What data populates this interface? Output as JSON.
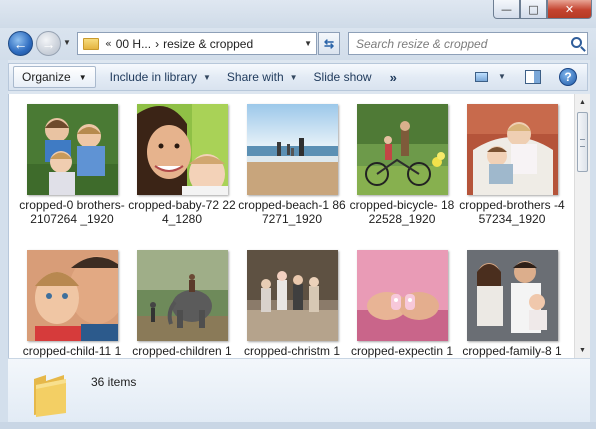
{
  "window": {
    "minimize": "—",
    "maximize": "□",
    "close": "✕"
  },
  "address_bar": {
    "overflow": "«",
    "crumbs": [
      "00 H...",
      "›",
      "resize & cropped"
    ]
  },
  "search": {
    "placeholder": "Search resize & cropped"
  },
  "toolbar": {
    "organize": "Organize",
    "include_in_library": "Include in library",
    "share_with": "Share with",
    "slide_show": "Slide show",
    "more": "»",
    "help": "?"
  },
  "files": [
    {
      "name": "cropped-0 brothers-2107264 _1920"
    },
    {
      "name": "cropped-baby-72 224_1280"
    },
    {
      "name": "cropped-beach-1 867271_1920"
    },
    {
      "name": "cropped-bicycle- 1822528_1920"
    },
    {
      "name": "cropped-brothers -457234_1920"
    },
    {
      "name": "cropped-child-11 1"
    },
    {
      "name": "cropped-children 1"
    },
    {
      "name": "cropped-christm 1"
    },
    {
      "name": "cropped-expectin 1"
    },
    {
      "name": "cropped-family-8 1"
    }
  ],
  "details": {
    "count": "36 items"
  },
  "colors": {
    "accent": "#1e395b",
    "frame": "#d3dfec",
    "selection": "#cce8ff"
  },
  "icons": [
    "back-arrow-icon",
    "forward-arrow-icon",
    "folder-icon",
    "refresh-icon",
    "search-icon",
    "view-icon",
    "preview-pane-icon",
    "help-icon"
  ]
}
